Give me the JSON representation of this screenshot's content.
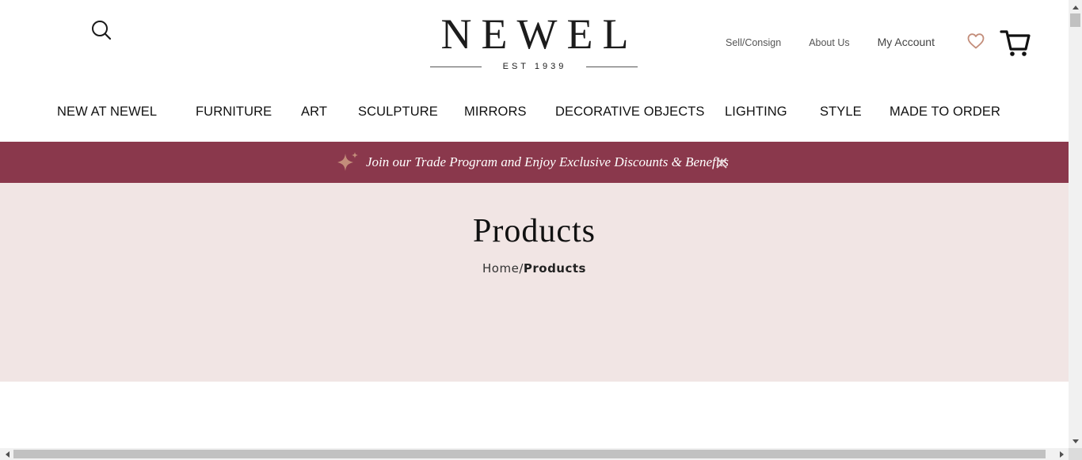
{
  "header": {
    "logo_text": "NEWEL",
    "logo_subtext": "EST 1939",
    "top_links": [
      "Sell/Consign",
      "About Us"
    ],
    "account_label": "My Account",
    "icons": [
      "search-icon",
      "heart-icon",
      "cart-icon"
    ]
  },
  "nav": {
    "items": [
      "NEW AT NEWEL",
      "FURNITURE",
      "ART",
      "SCULPTURE",
      "MIRRORS",
      "DECORATIVE OBJECTS",
      "LIGHTING",
      "STYLE",
      "MADE TO ORDER"
    ]
  },
  "banner": {
    "text": "Join our Trade Program and Enjoy Exclusive Discounts & Benefits",
    "icons": [
      "sparkle-icon",
      "close-icon"
    ]
  },
  "hero": {
    "title": "Products",
    "breadcrumb": {
      "home": "Home",
      "separator": "/",
      "current": "Products"
    }
  },
  "colors": {
    "banner_bg": "#8a384c",
    "hero_bg": "#f1e5e4",
    "accent_icon": "#c38d7a"
  }
}
